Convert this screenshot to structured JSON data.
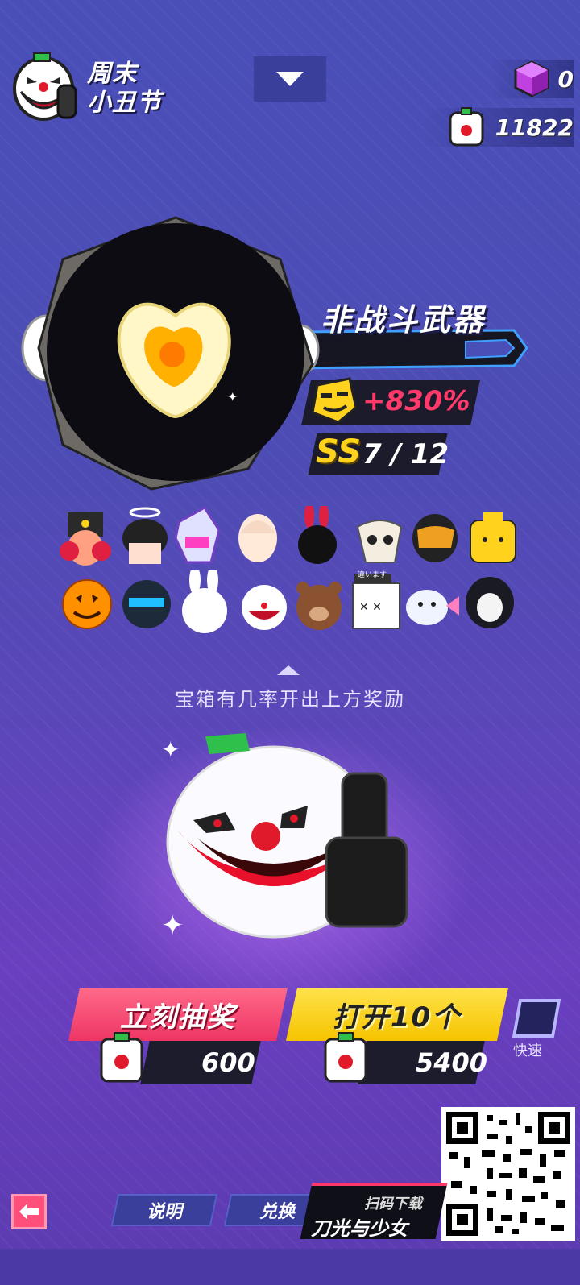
{
  "header": {
    "event_title_line1": "周末",
    "event_title_line2": "小丑节",
    "gems": "0",
    "tickets": "11822"
  },
  "weapon": {
    "name": "非战斗武器",
    "bonus": "+830%",
    "rank_grade": "SS",
    "rank_count": "7 / 12"
  },
  "rewards": {
    "row1": [
      "nutcracker-hat",
      "halo-hair",
      "purple-mask-helmet",
      "blonde-hair",
      "black-bunny",
      "ram-skull",
      "gold-visor-helmet",
      "yellow-lego-head"
    ],
    "row2": [
      "jack-o-lantern",
      "knight-helmet",
      "white-bunny",
      "clown-mask",
      "brown-bear",
      "cardboard-box-head",
      "fish-head",
      "reaper-hood"
    ],
    "box_label": "違います"
  },
  "hint": "宝箱有几率开出上方奖励",
  "actions": {
    "draw_once_label": "立刻抽奖",
    "draw_once_cost": "600",
    "open_ten_label": "打开10个",
    "open_ten_cost": "5400",
    "fast_label": "快速"
  },
  "nav": {
    "info_label": "说明",
    "exchange_label": "兑换"
  },
  "promo": {
    "small": "扫码下载",
    "big": "刀光与少女"
  },
  "colors": {
    "accent_pink": "#ff3a6a",
    "accent_yellow": "#ffd21e",
    "bg": "#4d4cb4"
  }
}
